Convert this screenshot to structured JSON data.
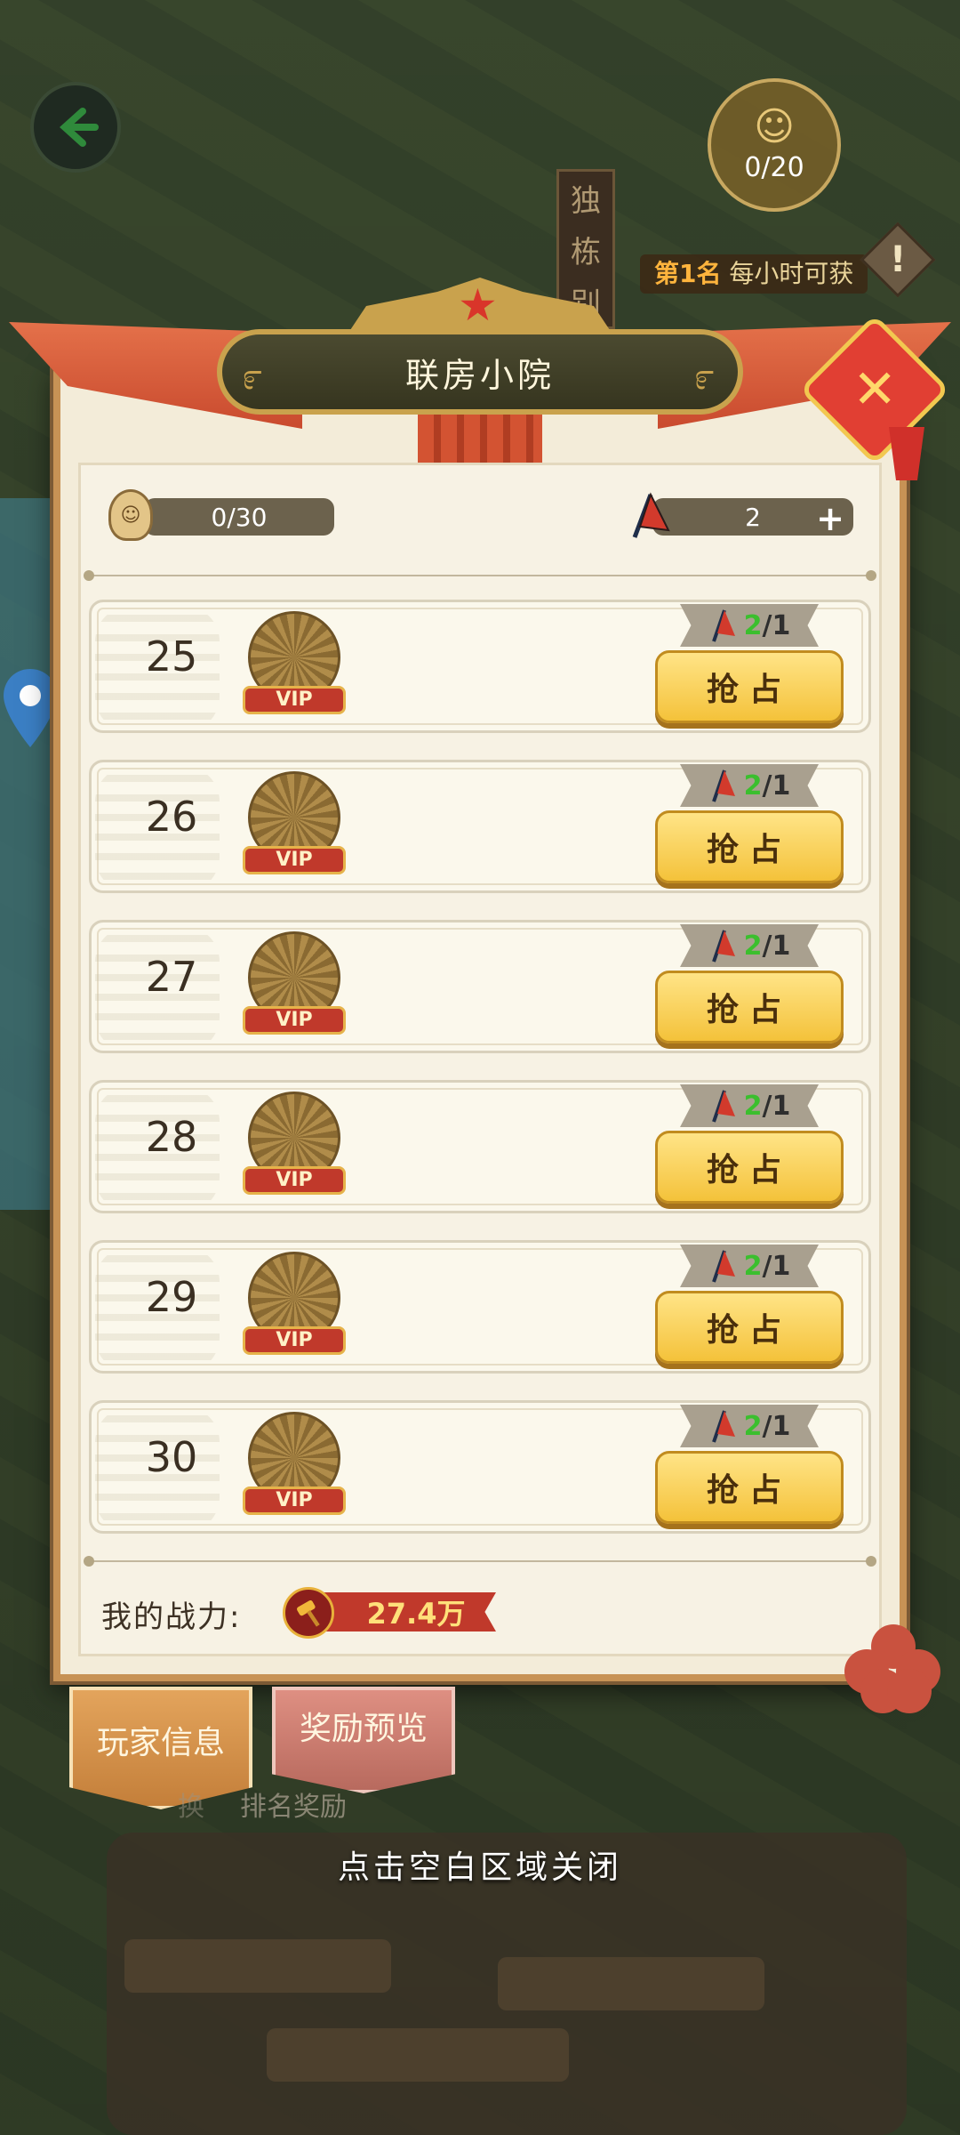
{
  "header": {
    "back_icon": "back-arrow-icon",
    "people_counter": "0/20",
    "vertical_sign": [
      "独",
      "栋",
      "别"
    ],
    "rank_prefix": "第1名",
    "rank_text": "每小时可获",
    "alert_glyph": "!"
  },
  "dialog": {
    "title": "联房小院",
    "close_glyph": "✕",
    "stats": {
      "people": "0/30",
      "flags": "2",
      "plus": "+"
    },
    "slots": [
      {
        "rank": "25",
        "vip": "VIP",
        "cost_have": "2",
        "cost_need": "/1",
        "action": "抢占"
      },
      {
        "rank": "26",
        "vip": "VIP",
        "cost_have": "2",
        "cost_need": "/1",
        "action": "抢占"
      },
      {
        "rank": "27",
        "vip": "VIP",
        "cost_have": "2",
        "cost_need": "/1",
        "action": "抢占"
      },
      {
        "rank": "28",
        "vip": "VIP",
        "cost_have": "2",
        "cost_need": "/1",
        "action": "抢占"
      },
      {
        "rank": "29",
        "vip": "VIP",
        "cost_have": "2",
        "cost_need": "/1",
        "action": "抢占"
      },
      {
        "rank": "30",
        "vip": "VIP",
        "cost_have": "2",
        "cost_need": "/1",
        "action": "抢占"
      }
    ],
    "power_label": "我的战力:",
    "power_value": "27.4万"
  },
  "tabs": {
    "player_info": "玩家信息",
    "reward_preview": "奖励预览",
    "behind": [
      "换",
      "排名奖励"
    ]
  },
  "close_hint": "点击空白区域关闭",
  "colors": {
    "accent_gold": "#f4c23a",
    "ribbon_red": "#c94a2e",
    "green_count": "#3bbf2e",
    "vip_red": "#c0392b"
  }
}
